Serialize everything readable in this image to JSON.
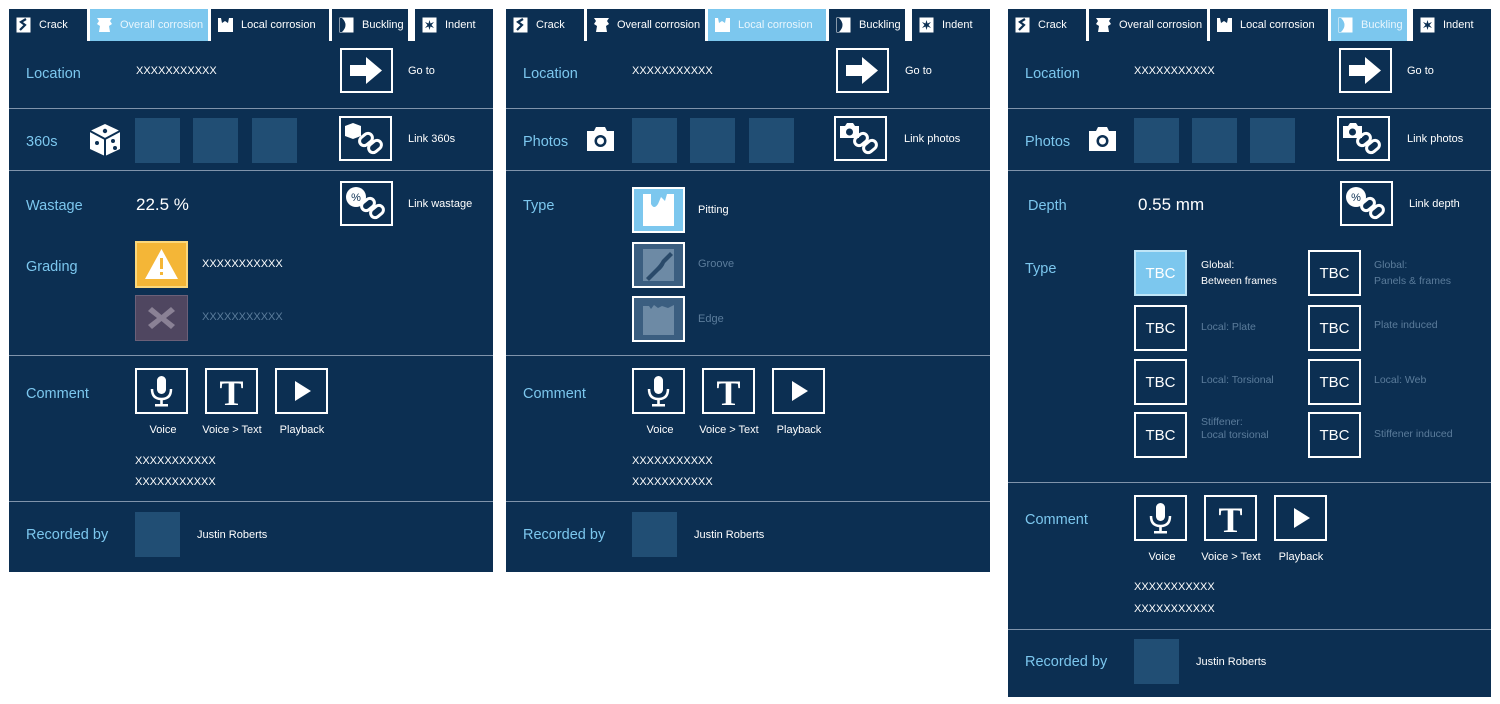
{
  "tabs": {
    "crack": "Crack",
    "overall_corrosion": "Overall corrosion",
    "local_corrosion": "Local corrosion",
    "buckling": "Buckling",
    "indent": "Indent"
  },
  "colors": {
    "panel": "#0c2f52",
    "accent": "#7cc7ee",
    "placeholder": "#214e74",
    "warning": "#f4b637",
    "muted": "#5b7c9b"
  },
  "common": {
    "location_label": "Location",
    "location_value": "XXXXXXXXXXX",
    "goto_label": "Go to",
    "comment_label": "Comment",
    "voice_label": "Voice",
    "voice_text_label": "Voice > Text",
    "playback_label": "Playback",
    "comment_line1": "XXXXXXXXXXX",
    "comment_line2": "XXXXXXXXXXX",
    "recorded_by_label": "Recorded by",
    "recorder_name": "Justin Roberts"
  },
  "overall": {
    "active_tab": "overall_corrosion",
    "media_label": "360s",
    "link_media_label": "Link 360s",
    "wastage_label": "Wastage",
    "wastage_value": "22.5 %",
    "link_wastage_label": "Link wastage",
    "grading_label": "Grading",
    "grading_options": [
      {
        "icon": "warning-icon",
        "label": "XXXXXXXXXXX",
        "selected": true
      },
      {
        "icon": "x-icon",
        "label": "XXXXXXXXXXX",
        "selected": false
      }
    ]
  },
  "local": {
    "active_tab": "local_corrosion",
    "media_label": "Photos",
    "link_media_label": "Link photos",
    "type_label": "Type",
    "type_options": [
      {
        "icon": "pitting-icon",
        "label": "Pitting",
        "selected": true
      },
      {
        "icon": "groove-icon",
        "label": "Groove",
        "selected": false
      },
      {
        "icon": "edge-icon",
        "label": "Edge",
        "selected": false
      }
    ]
  },
  "buckling": {
    "active_tab": "buckling",
    "media_label": "Photos",
    "link_media_label": "Link photos",
    "depth_label": "Depth",
    "depth_value": "0.55 mm",
    "link_depth_label": "Link depth",
    "type_label": "Type",
    "tbc": "TBC",
    "type_options": [
      {
        "line1": "Global:",
        "line2": "Between frames",
        "selected": true
      },
      {
        "line1": "Global:",
        "line2": "Panels & frames",
        "selected": false
      },
      {
        "line1": "Local: Plate",
        "line2": "",
        "selected": false
      },
      {
        "line1": "Plate induced",
        "line2": "",
        "selected": false
      },
      {
        "line1": "Local: Torsional",
        "line2": "",
        "selected": false
      },
      {
        "line1": "Local: Web",
        "line2": "",
        "selected": false
      },
      {
        "line1": "Stiffener:",
        "line2": "Local torsional",
        "selected": false
      },
      {
        "line1": "Stiffener induced",
        "line2": "",
        "selected": false
      }
    ]
  }
}
